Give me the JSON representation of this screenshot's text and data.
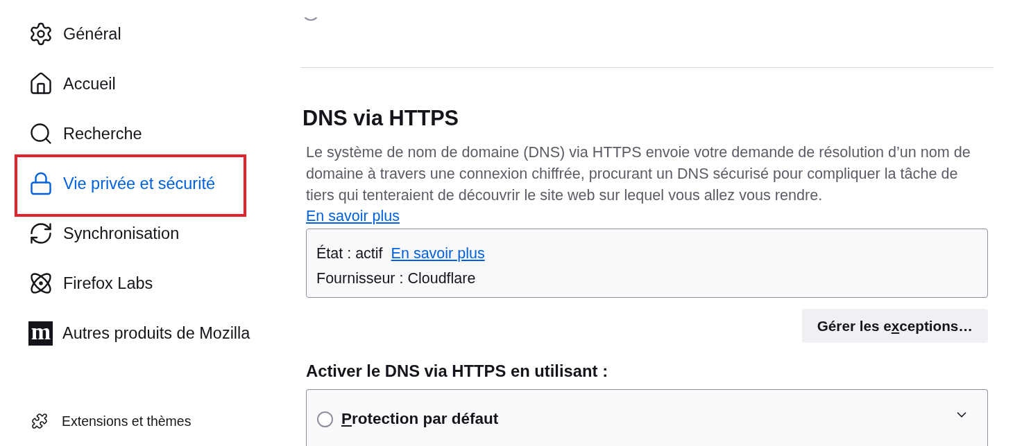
{
  "sidebar": {
    "items": [
      {
        "label": "Général",
        "selected": false,
        "highlighted": false
      },
      {
        "label": "Accueil",
        "selected": false,
        "highlighted": false
      },
      {
        "label": "Recherche",
        "selected": false,
        "highlighted": false
      },
      {
        "label": "Vie privée et sécurité",
        "selected": true,
        "highlighted": true
      },
      {
        "label": "Synchronisation",
        "selected": false,
        "highlighted": false
      },
      {
        "label": "Firefox Labs",
        "selected": false,
        "highlighted": false
      },
      {
        "label": "Autres produits de Mozilla",
        "logo_text": "m",
        "selected": false,
        "highlighted": false
      }
    ],
    "footer_items": [
      {
        "label": "Extensions et thèmes"
      }
    ]
  },
  "section": {
    "title": "DNS via HTTPS",
    "description": "Le système de nom de domaine (DNS) via HTTPS envoie votre demande de résolution d’un nom de domaine à travers une connexion chiffrée, procurant un DNS sécurisé pour compliquer la tâche de tiers qui tenteraient de découvrir le site web sur lequel vous allez vous rendre.",
    "learn_more": "En savoir plus",
    "status": {
      "state": "État : actif",
      "learn_more": "En savoir plus",
      "provider": "Fournisseur : Cloudflare"
    },
    "manage_button": {
      "label_start": "Gérer les e",
      "accesskey": "x",
      "label_end": "ceptions…"
    },
    "options_title": "Activer le DNS via HTTPS en utilisant :",
    "options": [
      {
        "accesskey": "P",
        "label_end": "rotection par défaut",
        "selected": false,
        "expanded": false
      }
    ]
  }
}
